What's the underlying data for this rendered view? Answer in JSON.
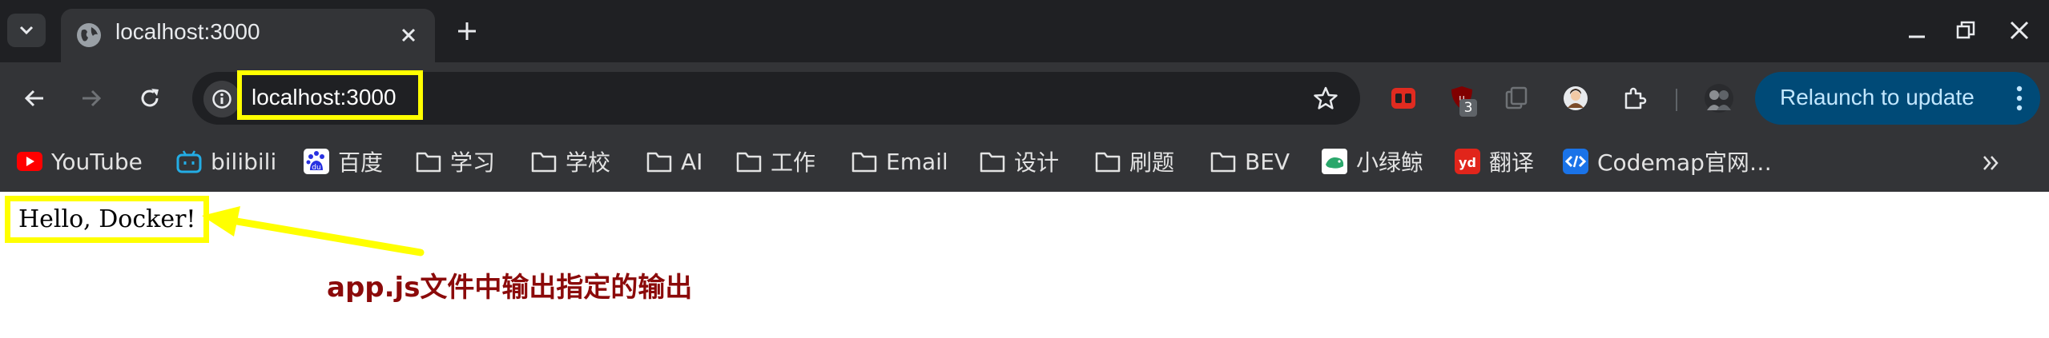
{
  "tab": {
    "title": "localhost:3000",
    "favicon": "globe-icon"
  },
  "omnibox": {
    "url": "localhost:3000"
  },
  "extensions": {
    "ublock_badge": "3"
  },
  "relaunch": {
    "label": "Relaunch to update"
  },
  "bookmarks": [
    {
      "label": "YouTube",
      "icon": "youtube-icon"
    },
    {
      "label": "bilibili",
      "icon": "bilibili-icon"
    },
    {
      "label": "百度",
      "icon": "baidu-icon"
    },
    {
      "label": "学习",
      "icon": "folder-icon"
    },
    {
      "label": "学校",
      "icon": "folder-icon"
    },
    {
      "label": "AI",
      "icon": "folder-icon"
    },
    {
      "label": "工作",
      "icon": "folder-icon"
    },
    {
      "label": "Email",
      "icon": "folder-icon"
    },
    {
      "label": "设计",
      "icon": "folder-icon"
    },
    {
      "label": "刷题",
      "icon": "folder-icon"
    },
    {
      "label": "BEV",
      "icon": "folder-icon"
    },
    {
      "label": "小绿鲸",
      "icon": "xiaolvjing-icon"
    },
    {
      "label": "翻译",
      "icon": "youdao-icon"
    },
    {
      "label": "Codemap官网…",
      "icon": "codemap-icon"
    }
  ],
  "page": {
    "content_text": "Hello, Docker!",
    "annotation": "app.js文件中输出指定的输出"
  },
  "colors": {
    "highlight": "#ffff00",
    "annotation": "#8b0a0a",
    "relaunch_bg": "#004a77",
    "relaunch_text": "#c2e7ff"
  }
}
